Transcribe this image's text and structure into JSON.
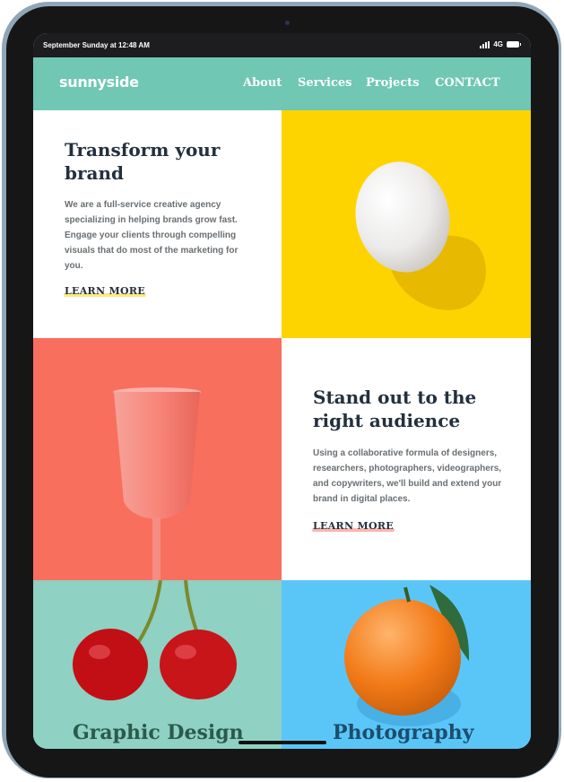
{
  "status_bar": {
    "time": "September Sunday at 12:48 AM",
    "network": "4G",
    "icons": [
      "signal-icon",
      "battery-icon"
    ]
  },
  "nav": {
    "logo": "sunnyside",
    "links": [
      "About",
      "Services",
      "Projects",
      "CONTACT"
    ]
  },
  "section_1": {
    "heading": "Transform your brand",
    "body": "We are a full-service creative agency specializing in helping brands grow fast. Engage your clients through compelling visuals that do most of the marketing for you.",
    "link": "LEARN MORE"
  },
  "section_2": {
    "heading": "Stand out to the right audience",
    "body": "Using a collaborative formula of designers, researchers, photographers, videographers, and copywriters, we'll build and extend your brand in digital places.",
    "link": "LEARN MORE"
  },
  "services": [
    {
      "title": "Graphic Design"
    },
    {
      "title": "Photography"
    }
  ],
  "colors": {
    "nav_bg": "#6fc7b4",
    "egg_bg": "#fed400",
    "cup_bg": "#f86f5e",
    "cherry_bg": "#8fd1c2",
    "orange_bg": "#5ac6f8",
    "heading": "#23303e",
    "body_text": "#6a6f73"
  },
  "images": [
    "egg-image",
    "cup-image",
    "cherries-image",
    "orange-image"
  ]
}
